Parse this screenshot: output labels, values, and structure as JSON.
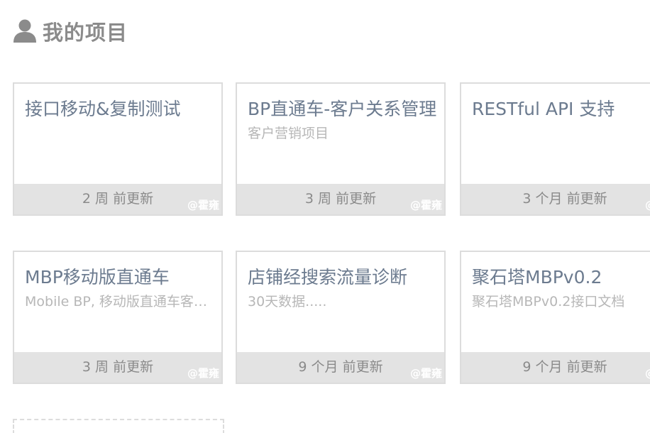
{
  "header": {
    "icon": "user-icon",
    "title": "我的项目"
  },
  "projects": [
    {
      "title": "接口移动&复制测试",
      "subtitle": "",
      "updated": "2 周 前更新",
      "owner": "@霍雍"
    },
    {
      "title": "BP直通车-客户关系管理",
      "subtitle": "客户营销项目",
      "updated": "3 周 前更新",
      "owner": "@霍雍"
    },
    {
      "title": "RESTful API 支持",
      "subtitle": "",
      "updated": "3 个月 前更新",
      "owner": "@霍"
    },
    {
      "title": "MBP移动版直通车",
      "subtitle": "Mobile BP, 移动版直通车客户端",
      "updated": "3 周 前更新",
      "owner": "@霍雍"
    },
    {
      "title": "店铺经搜索流量诊断",
      "subtitle": "30天数据.....",
      "updated": "9 个月 前更新",
      "owner": "@霍雍"
    },
    {
      "title": "聚石塔MBPv0.2",
      "subtitle": "聚石塔MBPv0.2接口文档",
      "updated": "9 个月 前更新",
      "owner": "@霍"
    }
  ],
  "colors": {
    "title_text": "#8b8b8b",
    "card_title": "#6c7b8f",
    "card_subtitle": "#b7b7b7",
    "card_border": "#dcdcdc",
    "footer_bg": "#e3e3e3",
    "footer_text": "#8a8a8a",
    "owner_text": "#ffffff"
  }
}
